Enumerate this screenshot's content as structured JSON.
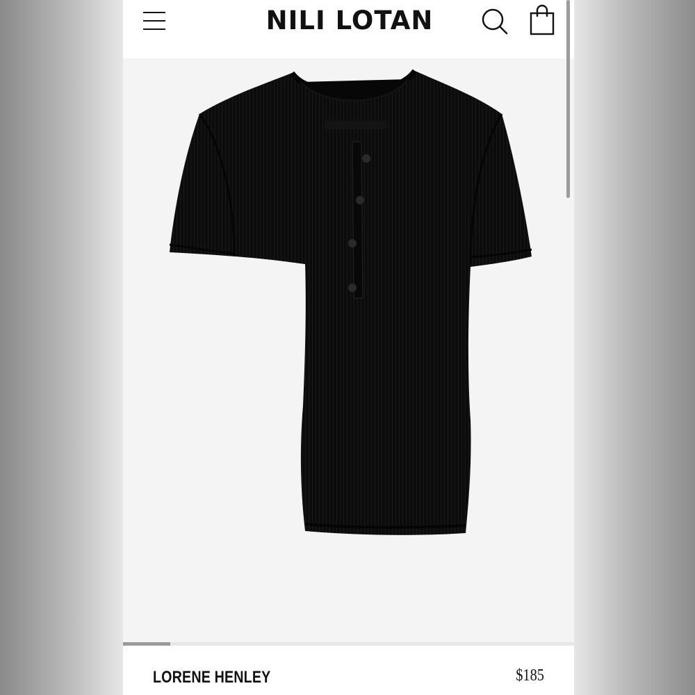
{
  "header": {
    "brand": "NILI LOTAN",
    "menu_icon": "hamburger-menu-icon",
    "search_icon": "search-icon",
    "bag_icon": "shopping-bag-icon"
  },
  "product": {
    "name": "LORENE HENLEY",
    "price": "$185",
    "image_description_icon": "black-henley-tshirt-image",
    "gallery_progress": 0.105
  },
  "colors": {
    "brand_text": "#111111",
    "image_background": "#f4f4f4",
    "garment": "#0d0d0d"
  }
}
